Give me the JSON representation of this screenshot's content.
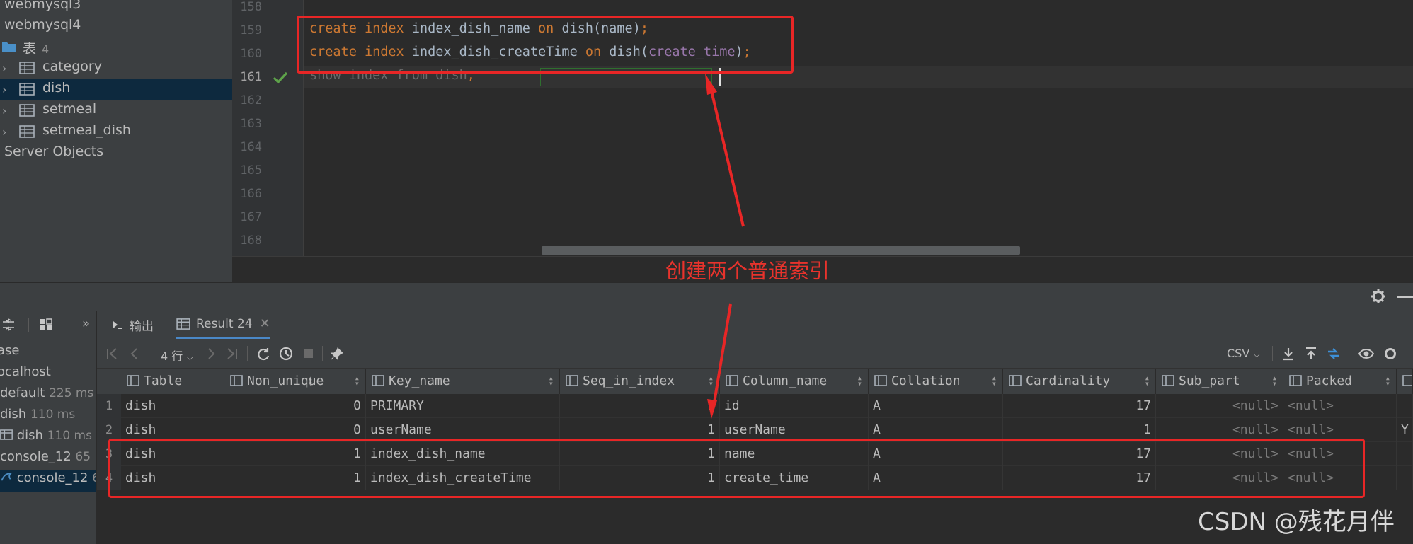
{
  "db_tree": {
    "items": [
      {
        "label": "webmysql3"
      },
      {
        "label": "webmysql4"
      },
      {
        "label": "表",
        "count": "4"
      },
      {
        "label": "category"
      },
      {
        "label": "dish"
      },
      {
        "label": "setmeal"
      },
      {
        "label": "setmeal_dish"
      },
      {
        "label": "Server Objects"
      }
    ]
  },
  "editor": {
    "line_numbers": [
      "158",
      "159",
      "160",
      "161",
      "162",
      "163",
      "164",
      "165",
      "166",
      "167",
      "168"
    ],
    "code": {
      "line159": {
        "kw1": "create",
        "kw2": "index",
        "name": "index_dish_name",
        "kw3": "on",
        "target": "dish(name)",
        "semi": ";"
      },
      "line160": {
        "kw1": "create",
        "kw2": "index",
        "name": "index_dish_createTime",
        "kw3": "on",
        "target_pre": "dish(",
        "arg": "create_time",
        "target_post": ")",
        "semi": ";"
      },
      "line161": {
        "text": "show index from dish",
        "semi": ";"
      }
    }
  },
  "annotation": {
    "label": "创建两个普通索引",
    "color": "#e82626"
  },
  "services": {
    "items": [
      {
        "label": "ase",
        "ms": ""
      },
      {
        "label": "ocalhost",
        "ms": ""
      },
      {
        "label": "default",
        "ms": "225 ms"
      },
      {
        "label": "dish",
        "ms": "110 ms"
      },
      {
        "label": "dish",
        "ms": "110 ms"
      },
      {
        "label": "console_12",
        "ms": "65 m"
      },
      {
        "label": "console_12",
        "ms": "6"
      }
    ]
  },
  "result_tabs": [
    {
      "label": "输出"
    },
    {
      "label": "Result 24"
    }
  ],
  "result_toolbar": {
    "rows_label": "4 行",
    "export_format": "CSV"
  },
  "grid": {
    "columns": [
      "Table",
      "Non_unique",
      "Key_name",
      "Seq_in_index",
      "Column_name",
      "Collation",
      "Cardinality",
      "Sub_part",
      "Packed"
    ],
    "rows": [
      {
        "n": "1",
        "table": "dish",
        "non_unique": "0",
        "key_name": "PRIMARY",
        "seq": "1",
        "column": "id",
        "collation": "A",
        "cardinality": "17",
        "sub_part": "<null>",
        "packed": "<null>",
        "extra": ""
      },
      {
        "n": "2",
        "table": "dish",
        "non_unique": "0",
        "key_name": "userName",
        "seq": "1",
        "column": "userName",
        "collation": "A",
        "cardinality": "1",
        "sub_part": "<null>",
        "packed": "<null>",
        "extra": "Y"
      },
      {
        "n": "3",
        "table": "dish",
        "non_unique": "1",
        "key_name": "index_dish_name",
        "seq": "1",
        "column": "name",
        "collation": "A",
        "cardinality": "17",
        "sub_part": "<null>",
        "packed": "<null>",
        "extra": ""
      },
      {
        "n": "4",
        "table": "dish",
        "non_unique": "1",
        "key_name": "index_dish_createTime",
        "seq": "1",
        "column": "create_time",
        "collation": "A",
        "cardinality": "17",
        "sub_part": "<null>",
        "packed": "<null>",
        "extra": ""
      }
    ]
  },
  "watermark": "CSDN @残花月伴"
}
